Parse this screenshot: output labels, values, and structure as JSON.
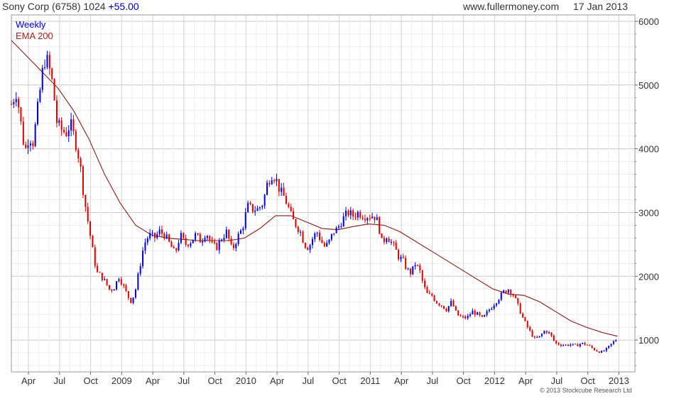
{
  "header": {
    "title": "Sony Corp (6758)",
    "last": "1024",
    "change": "+55.00",
    "website": "www.fullermoney.com",
    "date": "17 Jan 2013"
  },
  "legend": {
    "series1": "Weekly",
    "series2": "EMA 200"
  },
  "copyright": "© 2013 Stockcube Research Ltd",
  "colors": {
    "up": "#0000dd",
    "down": "#dd0000",
    "ema": "#8b1a1a",
    "grid": "#dcdcdc"
  },
  "chart_data": {
    "type": "line",
    "title": "Sony Corp (6758) 1024 +55.00",
    "y_ticks": [
      1000,
      2000,
      3000,
      4000,
      5000,
      6000
    ],
    "ylim": [
      500,
      6100
    ],
    "x_ticks": [
      {
        "label": "Apr",
        "t": 1.65
      },
      {
        "label": "Jul",
        "t": 4.65
      },
      {
        "label": "Oct",
        "t": 7.65
      },
      {
        "label": "2009",
        "t": 10.65
      },
      {
        "label": "Apr",
        "t": 13.65
      },
      {
        "label": "Jul",
        "t": 16.65
      },
      {
        "label": "Oct",
        "t": 19.65
      },
      {
        "label": "2010",
        "t": 22.65
      },
      {
        "label": "Apr",
        "t": 25.65
      },
      {
        "label": "Jul",
        "t": 28.65
      },
      {
        "label": "Oct",
        "t": 31.65
      },
      {
        "label": "2011",
        "t": 34.65
      },
      {
        "label": "Apr",
        "t": 37.65
      },
      {
        "label": "Jul",
        "t": 40.65
      },
      {
        "label": "Oct",
        "t": 43.65
      },
      {
        "label": "2012",
        "t": 46.65
      },
      {
        "label": "Apr",
        "t": 49.65
      },
      {
        "label": "Jul",
        "t": 52.65
      },
      {
        "label": "Oct",
        "t": 55.65
      },
      {
        "label": "2013",
        "t": 58.65
      }
    ],
    "series": [
      {
        "name": "Weekly",
        "points": [
          [
            0,
            4700
          ],
          [
            0.5,
            4900
          ],
          [
            1.0,
            4300
          ],
          [
            1.3,
            3950
          ],
          [
            1.7,
            4200
          ],
          [
            2.1,
            4100
          ],
          [
            2.6,
            4700
          ],
          [
            3.0,
            5200
          ],
          [
            3.3,
            5450
          ],
          [
            3.6,
            5300
          ],
          [
            4.0,
            5000
          ],
          [
            4.4,
            4400
          ],
          [
            4.8,
            4300
          ],
          [
            5.3,
            4250
          ],
          [
            5.7,
            4400
          ],
          [
            6.2,
            4100
          ],
          [
            6.6,
            3800
          ],
          [
            7.0,
            3250
          ],
          [
            7.3,
            2950
          ],
          [
            7.6,
            2650
          ],
          [
            8.0,
            2250
          ],
          [
            8.3,
            2050
          ],
          [
            8.7,
            2000
          ],
          [
            9.1,
            1900
          ],
          [
            9.5,
            1780
          ],
          [
            9.9,
            1820
          ],
          [
            10.4,
            2000
          ],
          [
            10.8,
            1850
          ],
          [
            11.2,
            1700
          ],
          [
            11.6,
            1600
          ],
          [
            12.0,
            1800
          ],
          [
            12.4,
            2150
          ],
          [
            12.8,
            2500
          ],
          [
            13.3,
            2650
          ],
          [
            13.8,
            2600
          ],
          [
            14.3,
            2700
          ],
          [
            14.8,
            2650
          ],
          [
            15.3,
            2500
          ],
          [
            15.8,
            2350
          ],
          [
            16.3,
            2650
          ],
          [
            16.8,
            2500
          ],
          [
            17.3,
            2550
          ],
          [
            17.8,
            2650
          ],
          [
            18.3,
            2550
          ],
          [
            18.8,
            2700
          ],
          [
            19.3,
            2500
          ],
          [
            19.8,
            2450
          ],
          [
            20.3,
            2600
          ],
          [
            20.8,
            2700
          ],
          [
            21.3,
            2400
          ],
          [
            21.8,
            2600
          ],
          [
            22.3,
            2750
          ],
          [
            22.8,
            3100
          ],
          [
            23.3,
            3050
          ],
          [
            23.8,
            3050
          ],
          [
            24.3,
            3150
          ],
          [
            24.7,
            3450
          ],
          [
            25.1,
            3600
          ],
          [
            25.5,
            3550
          ],
          [
            25.9,
            3350
          ],
          [
            26.3,
            3250
          ],
          [
            26.7,
            3100
          ],
          [
            27.1,
            2900
          ],
          [
            27.5,
            2800
          ],
          [
            27.9,
            2700
          ],
          [
            28.3,
            2500
          ],
          [
            28.7,
            2450
          ],
          [
            29.1,
            2600
          ],
          [
            29.5,
            2700
          ],
          [
            29.9,
            2550
          ],
          [
            30.3,
            2450
          ],
          [
            30.7,
            2550
          ],
          [
            31.1,
            2700
          ],
          [
            31.5,
            2750
          ],
          [
            32.0,
            2900
          ],
          [
            32.5,
            3000
          ],
          [
            33.0,
            2950
          ],
          [
            33.5,
            3000
          ],
          [
            34.0,
            2950
          ],
          [
            34.5,
            2950
          ],
          [
            35.0,
            2950
          ],
          [
            35.4,
            2850
          ],
          [
            35.8,
            2500
          ],
          [
            36.2,
            2650
          ],
          [
            36.6,
            2550
          ],
          [
            37.0,
            2450
          ],
          [
            37.4,
            2300
          ],
          [
            37.8,
            2250
          ],
          [
            38.2,
            2100
          ],
          [
            38.6,
            2050
          ],
          [
            39.0,
            2200
          ],
          [
            39.4,
            2100
          ],
          [
            39.8,
            1850
          ],
          [
            40.2,
            1700
          ],
          [
            40.6,
            1700
          ],
          [
            41.0,
            1600
          ],
          [
            41.5,
            1550
          ],
          [
            42.0,
            1480
          ],
          [
            42.5,
            1600
          ],
          [
            43.0,
            1400
          ],
          [
            43.5,
            1350
          ],
          [
            44.0,
            1350
          ],
          [
            44.5,
            1450
          ],
          [
            45.0,
            1400
          ],
          [
            45.5,
            1330
          ],
          [
            46.0,
            1450
          ],
          [
            46.5,
            1550
          ],
          [
            47.0,
            1650
          ],
          [
            47.5,
            1750
          ],
          [
            48.0,
            1800
          ],
          [
            48.5,
            1700
          ],
          [
            49.0,
            1500
          ],
          [
            49.5,
            1300
          ],
          [
            50.0,
            1150
          ],
          [
            50.5,
            1020
          ],
          [
            51.0,
            1050
          ],
          [
            51.5,
            1150
          ],
          [
            52.0,
            1100
          ],
          [
            52.5,
            950
          ],
          [
            53.0,
            930
          ],
          [
            53.5,
            920
          ],
          [
            54.0,
            930
          ],
          [
            54.5,
            910
          ],
          [
            55.0,
            950
          ],
          [
            55.5,
            930
          ],
          [
            56.0,
            880
          ],
          [
            56.5,
            830
          ],
          [
            57.0,
            810
          ],
          [
            57.5,
            860
          ],
          [
            58.0,
            950
          ],
          [
            58.5,
            1024
          ]
        ]
      },
      {
        "name": "EMA 200",
        "points": [
          [
            0,
            5700
          ],
          [
            1.5,
            5450
          ],
          [
            3.0,
            5200
          ],
          [
            4.5,
            4950
          ],
          [
            6.0,
            4600
          ],
          [
            7.5,
            4150
          ],
          [
            9.0,
            3600
          ],
          [
            10.5,
            3150
          ],
          [
            12.0,
            2800
          ],
          [
            13.5,
            2650
          ],
          [
            15.0,
            2600
          ],
          [
            16.5,
            2580
          ],
          [
            18.0,
            2560
          ],
          [
            19.5,
            2560
          ],
          [
            21.0,
            2560
          ],
          [
            22.5,
            2600
          ],
          [
            24.0,
            2750
          ],
          [
            25.5,
            2950
          ],
          [
            27.0,
            2950
          ],
          [
            28.5,
            2850
          ],
          [
            30.0,
            2750
          ],
          [
            31.5,
            2730
          ],
          [
            33.0,
            2780
          ],
          [
            34.5,
            2820
          ],
          [
            36.0,
            2800
          ],
          [
            37.5,
            2700
          ],
          [
            39.0,
            2550
          ],
          [
            40.5,
            2400
          ],
          [
            42.0,
            2250
          ],
          [
            43.5,
            2100
          ],
          [
            45.0,
            1950
          ],
          [
            46.5,
            1800
          ],
          [
            48.0,
            1720
          ],
          [
            49.5,
            1700
          ],
          [
            51.0,
            1600
          ],
          [
            52.5,
            1450
          ],
          [
            54.0,
            1300
          ],
          [
            55.5,
            1200
          ],
          [
            57.0,
            1120
          ],
          [
            58.5,
            1060
          ]
        ]
      }
    ]
  }
}
